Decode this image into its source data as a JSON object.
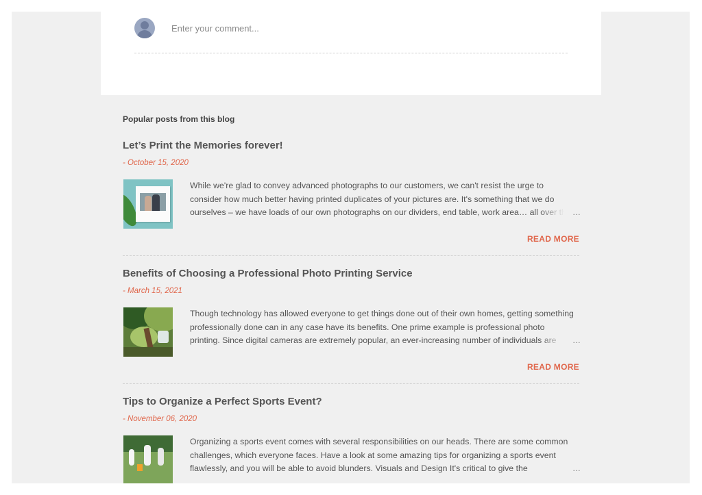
{
  "comment": {
    "placeholder": "Enter your comment..."
  },
  "popular": {
    "heading": "Popular posts from this blog",
    "read_more_label": "READ MORE",
    "ellipsis": "…",
    "posts": [
      {
        "title": "Let’s Print the Memories forever!",
        "date": "- October 15, 2020",
        "line1": "While we're glad to convey advanced photographs to our customers, we can't resist the urge to",
        "line2": "consider how much better having printed duplicates of your pictures are. It's something that we do",
        "line3": "ourselves – we have loads of our own photographs on our dividers, end table, work area… all over the"
      },
      {
        "title": "Benefits of Choosing a Professional Photo Printing Service",
        "date": "- March 15, 2021",
        "line1": "Though technology has allowed everyone to get things done out of their own homes, getting something",
        "line2": "professionally done can in any case have its benefits. One prime example is professional photo",
        "line3": "printing. Since digital cameras are extremely popular, an ever-increasing number of individuals are"
      },
      {
        "title": "Tips to Organize a Perfect Sports Event?",
        "date": "- November 06, 2020",
        "line1": "Organizing a sports event comes with several responsibilities on our heads. There are some common",
        "line2": "challenges, which everyone faces. Have a look at some amazing tips for organizing a sports event",
        "line3": "flawlessly, and you will be able to avoid blunders.  Visuals and Design It's critical to give the"
      }
    ]
  },
  "colors": {
    "accent": "#e0674c",
    "page_background": "#f0f0f0",
    "card_background": "#ffffff"
  }
}
